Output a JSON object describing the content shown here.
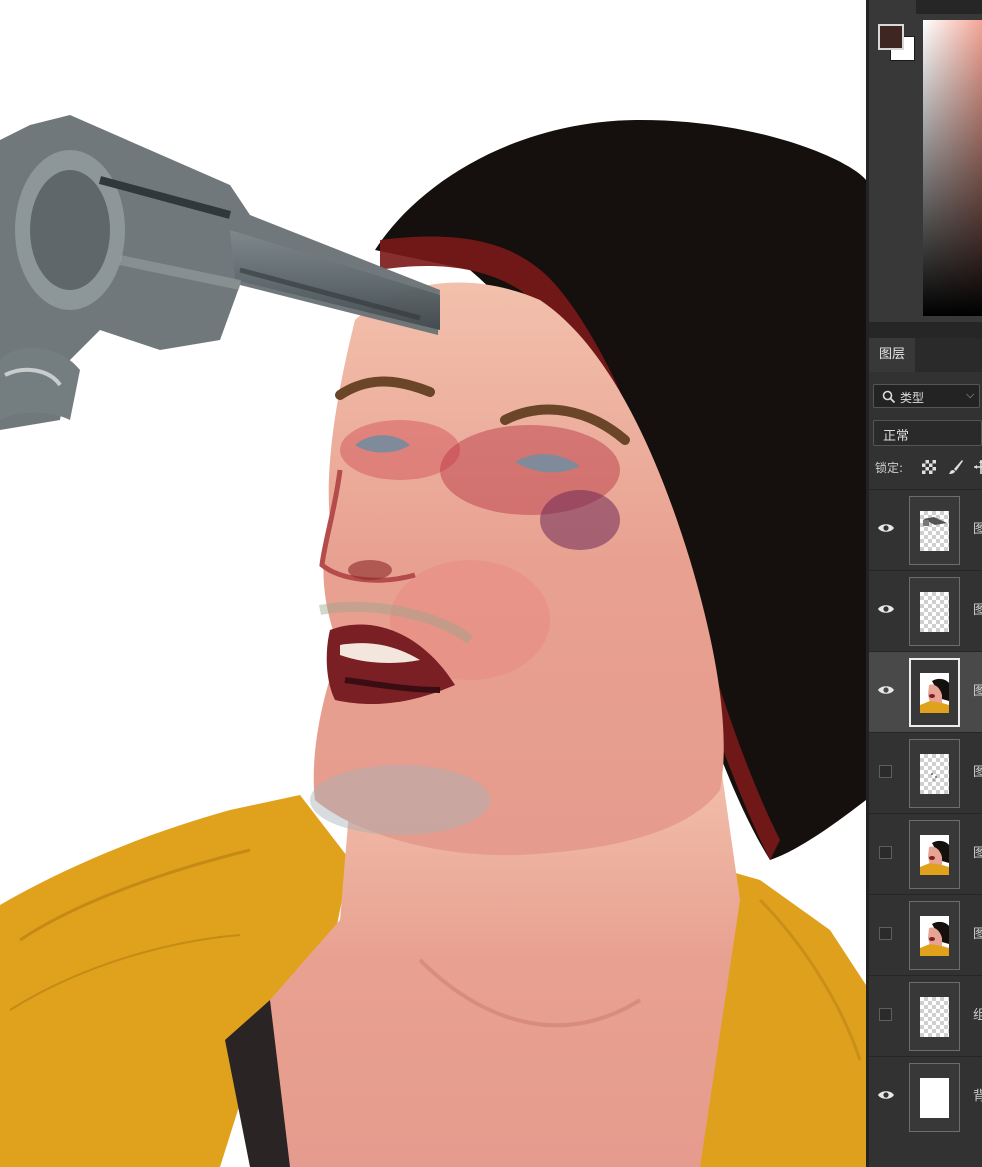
{
  "color_panel": {
    "foreground_color": "#3e2723",
    "background_color": "#ffffff"
  },
  "layers_panel": {
    "tab_label": "图层",
    "kind_filter": "类型",
    "blend_mode": "正常",
    "lock_label": "锁定:",
    "layers": [
      {
        "visible": true,
        "selected": false,
        "thumbnail": "gun-sketch",
        "type_glyph": "图"
      },
      {
        "visible": true,
        "selected": false,
        "thumbnail": "transparent",
        "type_glyph": "图"
      },
      {
        "visible": true,
        "selected": true,
        "thumbnail": "portrait",
        "type_glyph": "图"
      },
      {
        "visible": false,
        "selected": false,
        "thumbnail": "specks",
        "type_glyph": "图"
      },
      {
        "visible": false,
        "selected": false,
        "thumbnail": "portrait",
        "type_glyph": "图"
      },
      {
        "visible": false,
        "selected": false,
        "thumbnail": "portrait",
        "type_glyph": "图"
      },
      {
        "visible": false,
        "selected": false,
        "thumbnail": "transparent",
        "type_glyph": "组"
      },
      {
        "visible": true,
        "selected": false,
        "thumbnail": "white",
        "type_glyph": "背"
      }
    ]
  }
}
